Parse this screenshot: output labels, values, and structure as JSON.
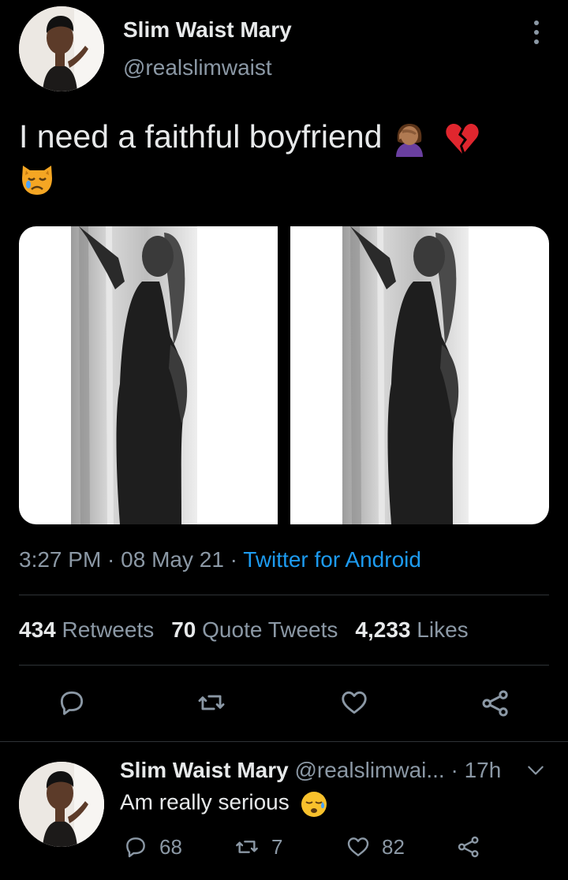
{
  "tweet": {
    "author_name": "Slim Waist Mary",
    "author_handle": "@realslimwaist",
    "text": "I need a faithful boyfriend",
    "text_emojis": [
      "woman-facepalming-emoji",
      "broken-heart-emoji",
      "crying-cat-emoji"
    ],
    "time": "3:27 PM · 08 May 21 · ",
    "source": "Twitter for Android",
    "stats": {
      "retweets_count": "434",
      "retweets_label": "Retweets",
      "quotes_count": "70",
      "quotes_label": "Quote Tweets",
      "likes_count": "4,233",
      "likes_label": "Likes"
    },
    "actions": [
      "reply-icon",
      "retweet-icon",
      "like-icon",
      "share-icon"
    ]
  },
  "reply": {
    "author_name": "Slim Waist Mary",
    "meta": "@realslimwai... · 17h",
    "text": "Am really serious",
    "text_emoji": "sleepy-face-emoji",
    "reply_count": "68",
    "retweet_count": "7",
    "like_count": "82"
  },
  "colors": {
    "background": "#000000",
    "text_primary": "#e7e9ea",
    "text_secondary": "#8b98a5",
    "link": "#1d9bf0",
    "divider": "#2f3336"
  }
}
